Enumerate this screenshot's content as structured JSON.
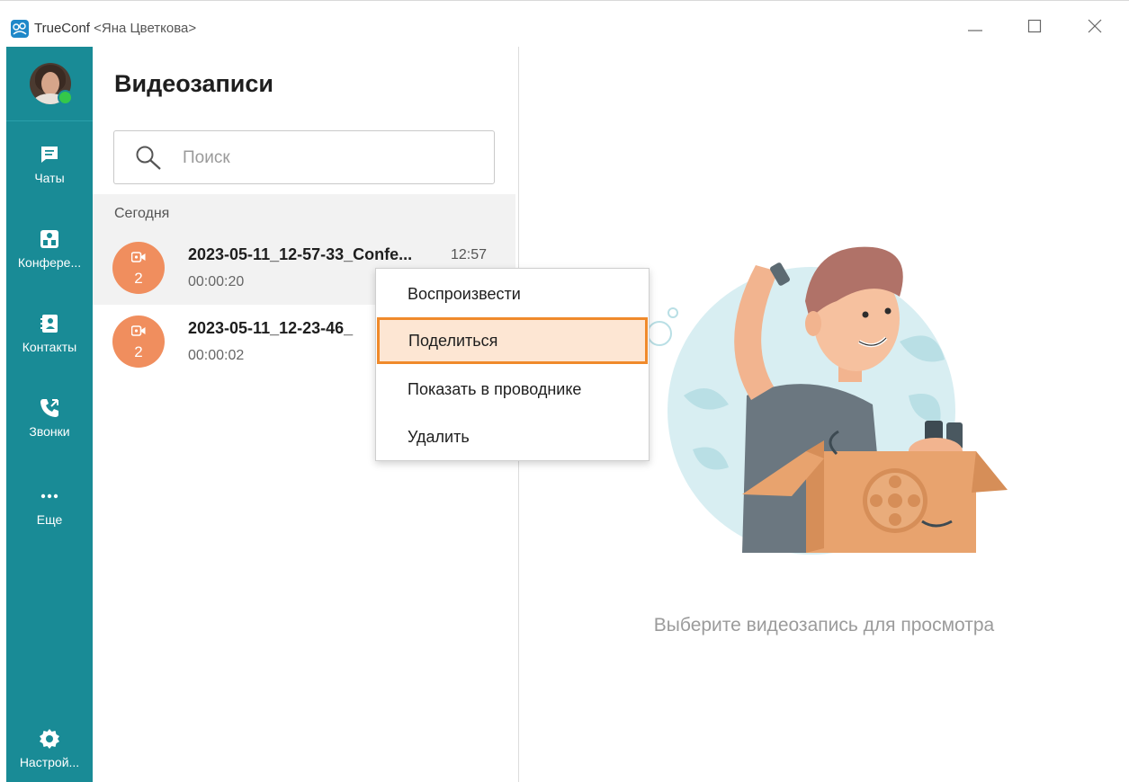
{
  "window": {
    "app_name": "TrueConf",
    "user": "<Яна Цветкова>"
  },
  "rail": {
    "items": [
      {
        "label": "Чаты",
        "icon": "chat-icon"
      },
      {
        "label": "Конфере...",
        "icon": "conference-icon"
      },
      {
        "label": "Контакты",
        "icon": "contacts-icon"
      },
      {
        "label": "Звонки",
        "icon": "calls-icon"
      },
      {
        "label": "Еще",
        "icon": "more-icon"
      }
    ],
    "settings": {
      "label": "Настрой...",
      "icon": "gear-icon"
    },
    "presence": "online"
  },
  "panel": {
    "title": "Видеозаписи",
    "search_placeholder": "Поиск",
    "section_label": "Сегодня",
    "records": [
      {
        "name": "2023-05-11_12-57-33_Confe...",
        "duration": "00:00:20",
        "time": "12:57",
        "count": "2"
      },
      {
        "name": "2023-05-11_12-23-46_",
        "duration": "00:00:02",
        "time": "",
        "count": "2"
      }
    ]
  },
  "context_menu": {
    "items": [
      {
        "label": "Воспроизвести"
      },
      {
        "label": "Поделиться",
        "highlighted": true
      },
      {
        "label": "Показать в проводнике"
      },
      {
        "label": "Удалить"
      }
    ]
  },
  "main": {
    "placeholder": "Выберите видеозапись для просмотра"
  },
  "colors": {
    "rail": "#198b96",
    "badge": "#f08e5e",
    "highlight_border": "#f08a2b",
    "highlight_fill": "#fde6d3",
    "presence": "#34c84a"
  }
}
